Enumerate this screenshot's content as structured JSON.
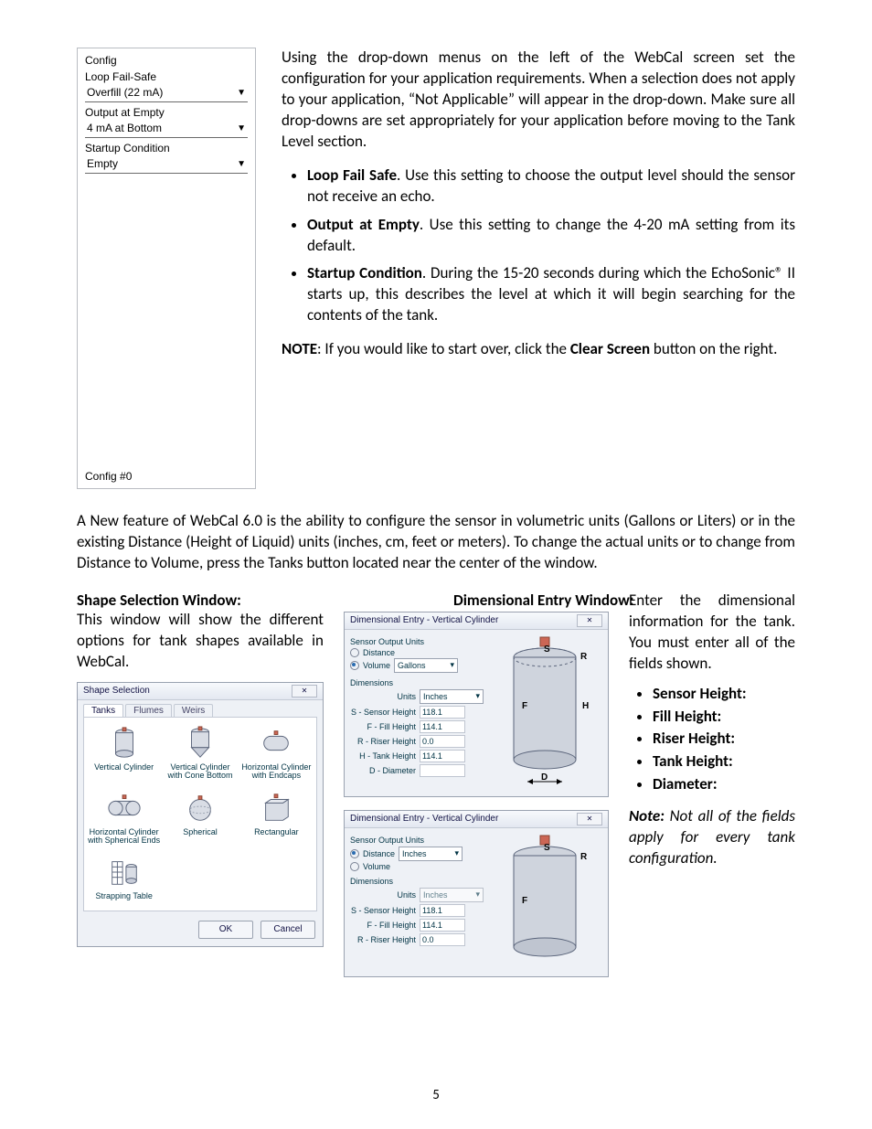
{
  "config_panel": {
    "title": "Config",
    "items": [
      {
        "label": "Loop Fail-Safe",
        "value": "Overfill (22 mA)"
      },
      {
        "label": "Output at Empty",
        "value": "4 mA at Bottom"
      },
      {
        "label": "Startup Condition",
        "value": "Empty"
      }
    ],
    "footer": "Config #0"
  },
  "top_paragraph": "Using the drop-down menus on the left of the WebCal screen set the configuration for your application requirements. When a selection does not apply to your application, “Not Applicable” will appear in the drop-down. Make sure all drop-downs are set appropriately for your application before moving to the Tank Level section.",
  "top_bullets": [
    {
      "lead": "Loop Fail Safe",
      "rest": ". Use this setting to choose the output level should the sensor not receive an echo."
    },
    {
      "lead": "Output at Empty",
      "rest": ". Use this setting to change the 4-20 mA setting from its default."
    },
    {
      "lead": "Startup Condition",
      "rest": ". During the 15-20 seconds during which the EchoSonic® II starts up, this describes the level at which it will begin searching for the contents of the tank."
    }
  ],
  "top_note": {
    "lead": "NOTE",
    "mid": ": If you would like to start over, click the ",
    "btn": "Clear Screen",
    "tail": " button on the right."
  },
  "wide_paragraph": "A New feature of WebCal 6.0 is the ability to configure the sensor in volumetric units (Gallons or Liters) or in the existing Distance (Height of Liquid) units (inches, cm, feet or meters).  To change the actual units or to change from Distance to Volume, press the Tanks button located near the center of the window.",
  "shape_section": {
    "title": "Shape Selection Window",
    "desc": "This window will show the different options for tank shapes available in WebCal.",
    "win_title": "Shape Selection",
    "tabs": [
      "Tanks",
      "Flumes",
      "Weirs"
    ],
    "shapes": [
      "Vertical Cylinder",
      "Vertical Cylinder with Cone Bottom",
      "Horizontal Cylinder with Endcaps",
      "Horizontal Cylinder with Spherical Ends",
      "Spherical",
      "Rectangular",
      "Strapping Table"
    ],
    "ok": "OK",
    "cancel": "Cancel"
  },
  "dim_section": {
    "title": "Dimensional Entry Window:",
    "desc": "Enter the dimensional information for the tank.  You must enter all of the fields shown.",
    "list": [
      "Sensor Height:",
      "Fill Height:",
      "Riser Height:",
      "Tank Height:",
      "Diameter:"
    ],
    "note": "Note:  Not all of the fields apply for every tank configuration.",
    "win_title": "Dimensional Entry - Vertical Cylinder",
    "group_output": "Sensor Output Units",
    "radio_distance": "Distance",
    "radio_volume": "Volume",
    "unit_gallons": "Gallons",
    "unit_inches": "Inches",
    "group_dims": "Dimensions",
    "units_label": "Units",
    "fields_full": [
      {
        "label": "S - Sensor Height",
        "value": "118.1"
      },
      {
        "label": "F - Fill Height",
        "value": "114.1"
      },
      {
        "label": "R - Riser Height",
        "value": "0.0"
      },
      {
        "label": "H - Tank Height",
        "value": "114.1"
      },
      {
        "label": "D - Diameter",
        "value": ""
      }
    ],
    "fields_short": [
      {
        "label": "S - Sensor Height",
        "value": "118.1"
      },
      {
        "label": "F - Fill Height",
        "value": "114.1"
      },
      {
        "label": "R - Riser Height",
        "value": "0.0"
      }
    ]
  },
  "page_number": "5"
}
